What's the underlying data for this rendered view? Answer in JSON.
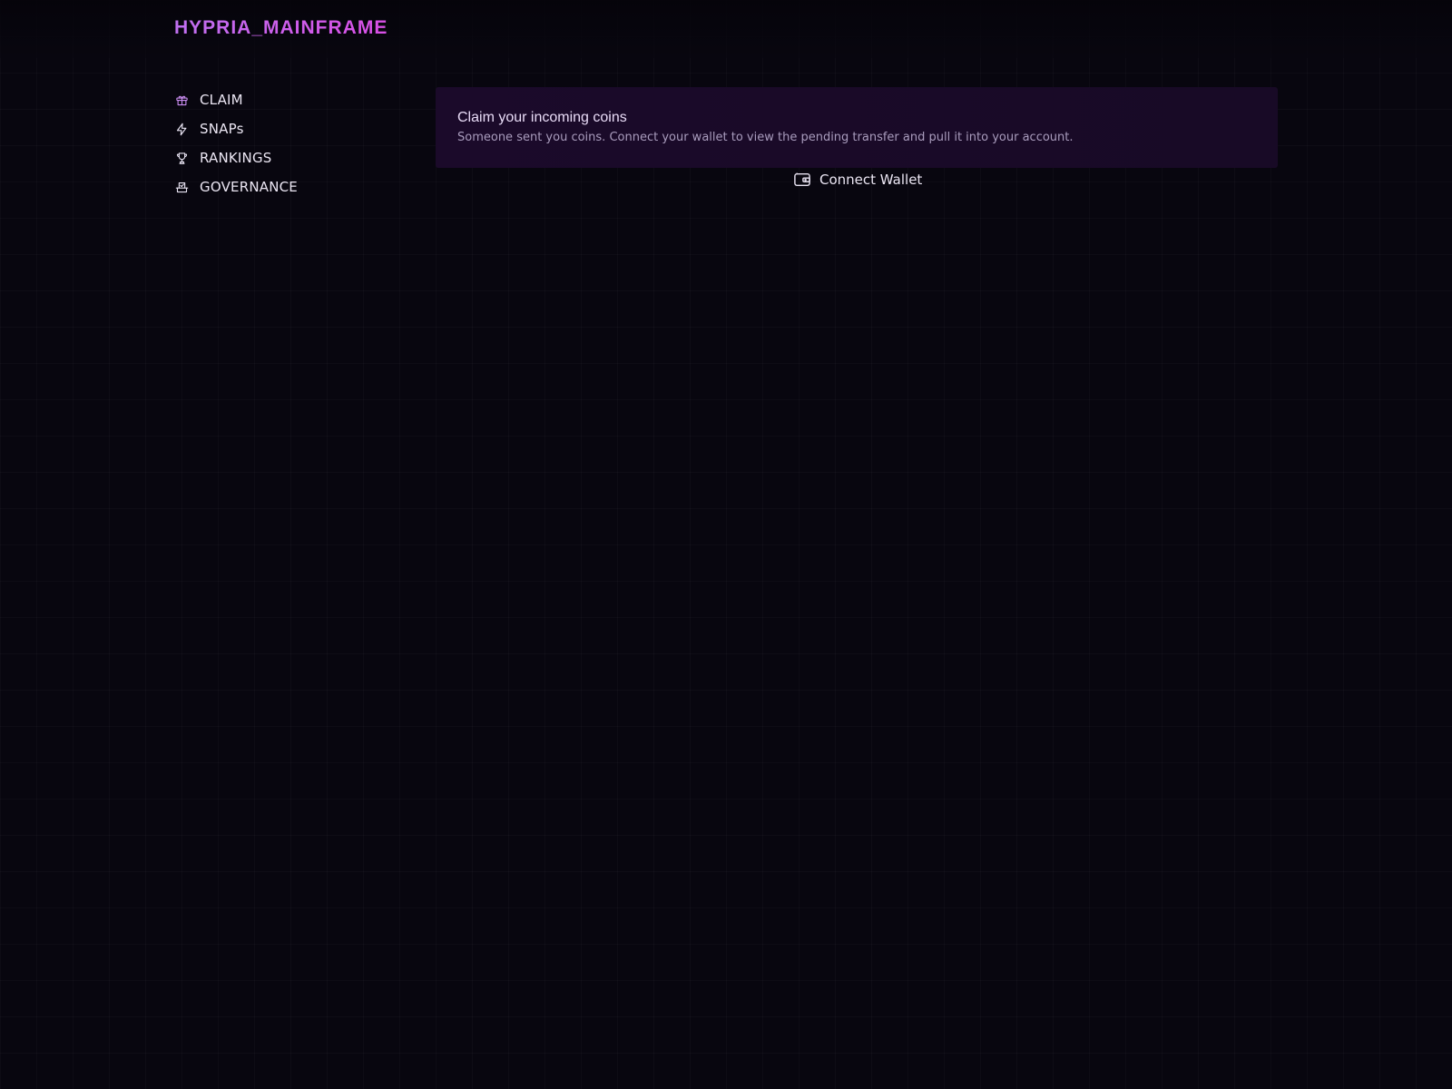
{
  "app": {
    "brand": "HYPRIA_MAINFRAME"
  },
  "sidebar": {
    "items": [
      {
        "label": "CLAIM",
        "icon": "gift-icon",
        "active": true
      },
      {
        "label": "SNAPs",
        "icon": "lightning-icon",
        "active": false
      },
      {
        "label": "RANKINGS",
        "icon": "trophy-icon",
        "active": false
      },
      {
        "label": "GOVERNANCE",
        "icon": "ballot-box-icon",
        "active": false
      }
    ]
  },
  "main": {
    "card": {
      "title": "Claim your incoming coins",
      "description": "Someone sent you coins. Connect your wallet to view the pending transfer and pull it into your account."
    },
    "connect_button": {
      "label": "Connect Wallet",
      "icon": "wallet-icon"
    }
  },
  "colors": {
    "background": "#08060f",
    "brand_start": "#c070f0",
    "brand_end": "#d94fe6",
    "active_icon": "#c98cf0",
    "card_bg": "#1b0a2a",
    "text_primary": "#ebe6f3",
    "text_muted": "#a99cbd"
  }
}
